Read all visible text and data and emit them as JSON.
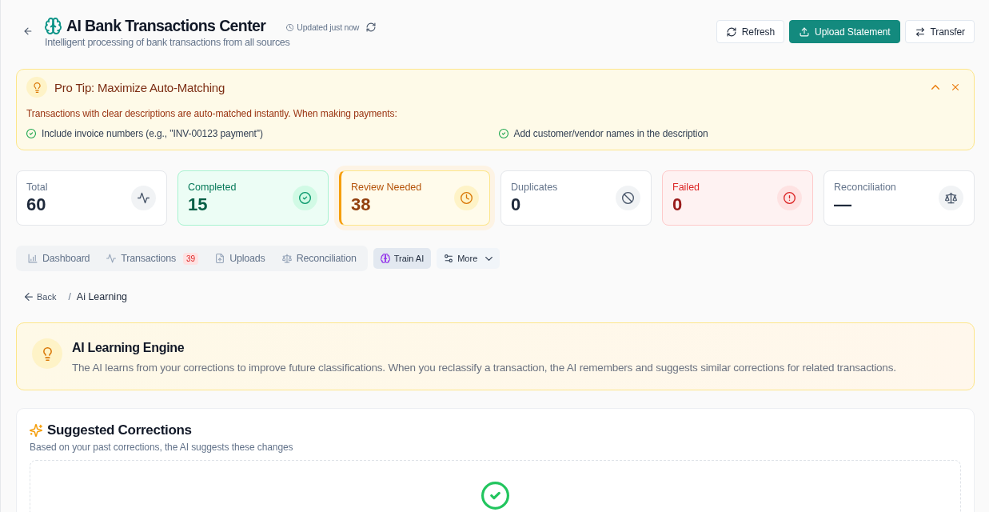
{
  "header": {
    "title": "AI Bank Transactions Center",
    "subtitle": "Intelligent processing of bank transactions from all sources",
    "updated": "Updated just now"
  },
  "actions": [
    {
      "label": "Refresh",
      "kind": "outline"
    },
    {
      "label": "Upload Statement",
      "kind": "primary"
    },
    {
      "label": "Transfer",
      "kind": "outline"
    }
  ],
  "tip": {
    "title": "Pro Tip: Maximize Auto-Matching",
    "text": "Transactions with clear descriptions are auto-matched instantly. When making payments:",
    "points": [
      "Include invoice numbers (e.g., \"INV-00123 payment\")",
      "Add customer/vendor names in the description"
    ]
  },
  "stats": [
    {
      "label": "Total",
      "value": "60",
      "kind": "neutral",
      "selected": false
    },
    {
      "label": "Completed",
      "value": "15",
      "kind": "success",
      "selected": false
    },
    {
      "label": "Review Needed",
      "value": "38",
      "kind": "warning",
      "selected": true
    },
    {
      "label": "Duplicates",
      "value": "0",
      "kind": "neutral",
      "selected": false
    },
    {
      "label": "Failed",
      "value": "0",
      "kind": "danger",
      "selected": false
    },
    {
      "label": "Reconciliation",
      "value": "—",
      "kind": "neutral",
      "selected": false
    }
  ],
  "tabs": [
    {
      "label": "Dashboard",
      "selected": false
    },
    {
      "label": "Transactions",
      "badge": "39",
      "selected": false
    },
    {
      "label": "Uploads",
      "selected": false
    },
    {
      "label": "Reconciliation",
      "selected": false
    }
  ],
  "train_ai": {
    "label": "Train AI",
    "selected": true
  },
  "more": {
    "label": "More"
  },
  "breadcrumb": {
    "back": "Back",
    "separator": "/",
    "current": "Ai Learning"
  },
  "learning": {
    "title": "AI Learning Engine",
    "text": "The AI learns from your corrections to improve future classifications. When you reclassify a transaction, the AI remembers and suggests similar corrections for related transactions."
  },
  "suggestions": {
    "title": "Suggested Corrections",
    "subtitle": "Based on your past corrections, the AI suggests these changes"
  }
}
